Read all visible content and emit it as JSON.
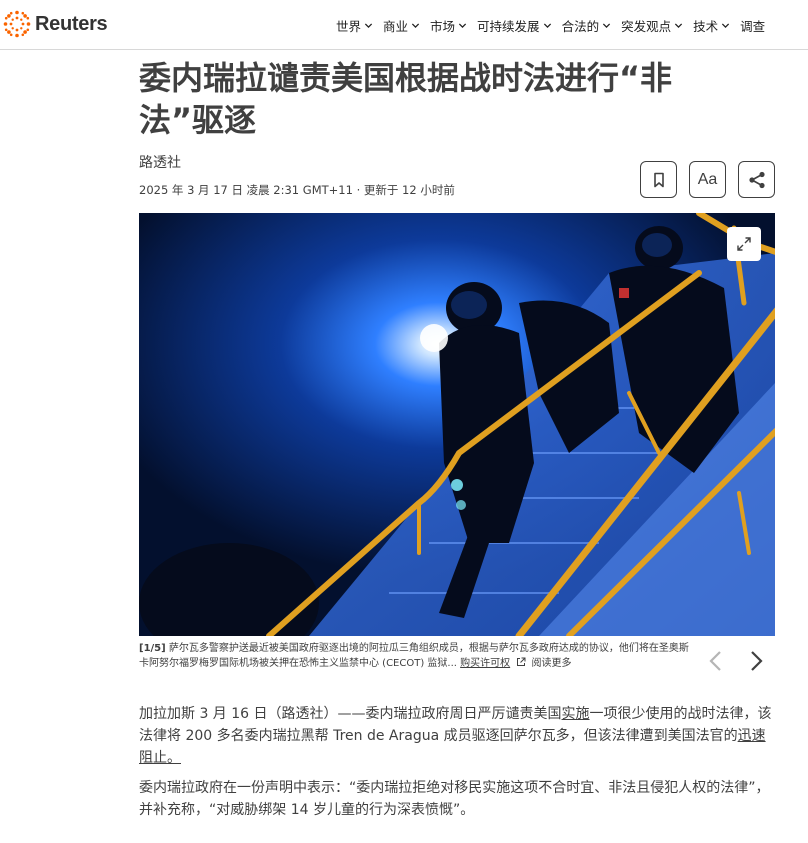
{
  "header": {
    "logo_text": "Reuters",
    "nav": [
      {
        "label": "世界"
      },
      {
        "label": "商业"
      },
      {
        "label": "市场"
      },
      {
        "label": "可持续发展"
      },
      {
        "label": "合法的"
      },
      {
        "label": "突发观点"
      },
      {
        "label": "技术"
      },
      {
        "label": "调查"
      }
    ]
  },
  "article": {
    "headline": "委内瑞拉谴责美国根据战时法进行“非法”驱逐",
    "byline": "路透社",
    "dateline": "2025 年 3 月 17 日 凌晨 2:31 GMT+11 · 更新于 12 小时前",
    "font_button_label": "Aa"
  },
  "photo": {
    "caption_index": "[1/5]",
    "caption_text": "萨尔瓦多警察护送最近被美国政府驱逐出境的阿拉瓜三角组织成员，根据与萨尔瓦多政府达成的协议，他们将在圣奥斯卡阿努尔福罗梅罗国际机场被关押在恐怖主义监禁中心 (CECOT) 监狱...",
    "license_link": "购买许可权",
    "read_more": "阅读更多"
  },
  "body": {
    "p1_before": "加拉加斯 3 月 16 日（路透社）——委内瑞拉政府周日严厉谴责美国",
    "p1_link1": "实施",
    "p1_middle": "一项很少使用的战时法律，该法律将 200 多名委内瑞拉黑帮 Tren de Aragua 成员驱逐回萨尔瓦多，但该法律遭到美国法官的",
    "p1_link2": "迅速阻止。",
    "p2": "委内瑞拉政府在一份声明中表示：“委内瑞拉拒绝对移民实施这项不合时宜、非法且侵犯人权的法律”，并补充称，“对威胁绑架 14 岁儿童的行为深表愤慨”。"
  },
  "colors": {
    "brand_orange": "#fa6400",
    "text": "#404040",
    "photo_bg": "#061b47",
    "rail": "#e0a020"
  },
  "icons": [
    "reuters-logo-icon",
    "chevron-down-icon",
    "bookmark-icon",
    "share-icon",
    "expand-icon",
    "external-link-icon",
    "arrow-left-icon",
    "arrow-right-icon"
  ]
}
